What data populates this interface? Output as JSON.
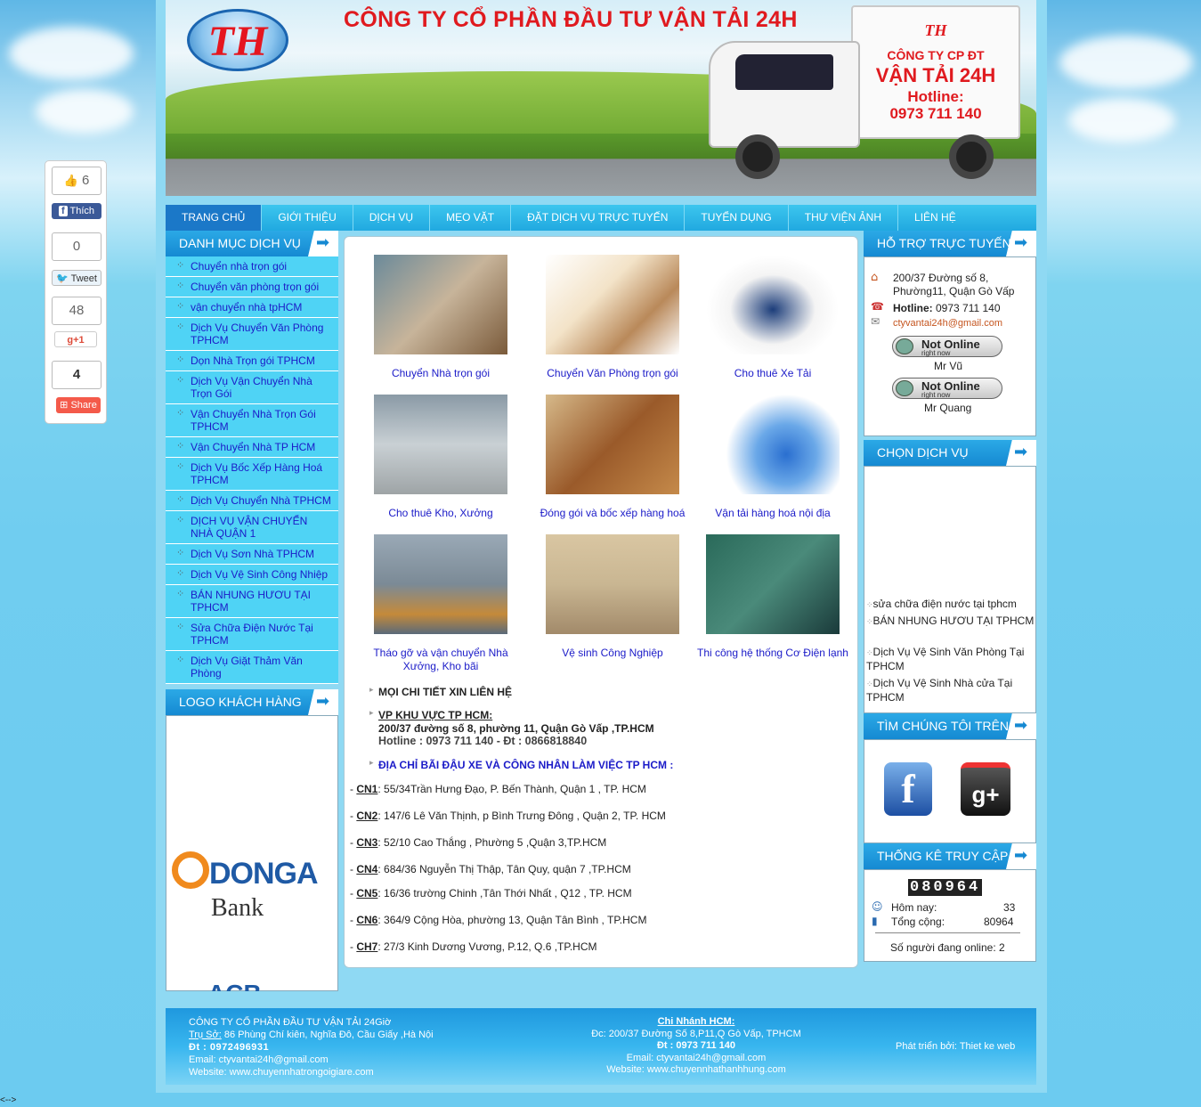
{
  "banner": {
    "logo": "TH",
    "title": "CÔNG TY CỔ PHẦN ĐẦU TƯ VẬN TẢI 24H",
    "truck_logo": "TH",
    "truck_line1": "CÔNG TY CP ĐT",
    "truck_line2": "VẬN TẢI 24H",
    "truck_line3": "Hotline:",
    "truck_line4": "0973 711 140"
  },
  "nav": [
    "TRANG CHỦ",
    "GIỚI THIỆU",
    "DỊCH VỤ",
    "MẸO VẶT",
    "ĐẶT DỊCH VỤ TRỰC TUYẾN",
    "TUYỂN DỤNG",
    "THƯ VIỆN ẢNH",
    "LIÊN HỆ"
  ],
  "left": {
    "menu_title": "DANH MỤC DỊCH VỤ",
    "items": [
      "Chuyển nhà trọn gói",
      "Chuyển văn phòng trọn gói",
      "vận chuyển nhà tpHCM",
      "Dịch Vụ Chuyển Văn Phòng TPHCM",
      "Dọn Nhà Trọn gói TPHCM",
      "Dịch Vụ Vận Chuyển Nhà Trọn Gói",
      "Vận Chuyển Nhà Trọn Gói TPHCM",
      "Vận Chuyển Nhà TP HCM",
      "Dịch Vụ Bốc Xếp Hàng Hoá TPHCM",
      "Dịch Vụ Chuyển Nhà TPHCM",
      "DỊCH VỤ VẬN CHUYỂN NHÀ QUẬN 1",
      "Dịch Vụ Sơn Nhà TPHCM",
      "Dịch Vụ Vệ Sinh Công Nhiệp",
      "BÁN NHUNG HƯƠU TẠI TPHCM",
      "Sửa Chữa Điện Nước Tại TPHCM",
      "Dịch Vụ Giặt Thảm Văn Phòng"
    ],
    "logos_title": "LOGO KHÁCH HÀNG",
    "donga_1": "DONGA",
    "donga_2": "Bank",
    "acb": "ACB"
  },
  "services": [
    "Chuyển Nhà trọn gói",
    "Chuyển Văn Phòng trọn gói",
    "Cho thuê Xe Tải",
    "Cho thuê Kho, Xưởng",
    "Đóng gói và bốc xếp hàng hoá",
    "Vận tải hàng hoá nội địa",
    "Tháo gỡ và vận chuyển Nhà Xưởng, Kho bãi",
    "Vệ sinh Công Nghiệp",
    "Thi công hệ thống Cơ Điện lạnh"
  ],
  "contact": {
    "line1": "MỌI CHI TIẾT XIN LIÊN HỆ",
    "vp_title": "VP KHU VỰC TP HCM:",
    "vp_addr": "200/37 đường số 8, phường 11, Quận Gò Vấp ,TP.HCM",
    "vp_phone": "Hotline : 0973 711 140 - Đt : 0866818840",
    "parking": "ĐỊA CHỈ BÃI ĐẬU XE VÀ CÔNG NHÂN LÀM VIỆC TP HCM :"
  },
  "branches": [
    {
      "code": "CN1",
      "addr": ": 55/34Trần Hưng Đạo, P. Bến Thành, Quận 1 , TP. HCM"
    },
    {
      "code": "CN2",
      "addr": ": 147/6 Lê Văn Thịnh, p Bình Trưng Đông , Quận 2, TP. HCM"
    },
    {
      "code": "CN3",
      "addr": ": 52/10 Cao Thắng , Phường 5 ,Quận 3,TP.HCM"
    },
    {
      "code": "CN4",
      "addr": ": 684/36 Nguyễn Thị Thập, Tân Quy, quận 7 ,TP.HCM"
    },
    {
      "code": "CN5",
      "addr": ": 16/36 trường Chinh ,Tân Thới Nhất , Q12 , TP. HCM"
    },
    {
      "code": "CN6",
      "addr": ": 364/9 Cộng Hòa, phường 13, Quận Tân Bình , TP.HCM"
    },
    {
      "code": "CH7",
      "addr": ": 27/3 Kinh Dương Vương, P.12, Q.6 ,TP.HCM"
    }
  ],
  "right": {
    "support_title": "HỖ TRỢ TRỰC TUYẾN",
    "addr1": "200/37 Đường số 8,",
    "addr2": "Phường11, Quận Gò Vấp",
    "hotline_label": "Hotline:",
    "hotline": " 0973 711 140",
    "email": "ctyvantai24h@gmail.com",
    "yahoo_status": "Not Online",
    "yahoo_sub": "right now",
    "support1": "Mr Vũ",
    "support2": "Mr Quang",
    "choose_title": "CHỌN DỊCH VỤ",
    "choose_items": [
      "sửa chữa điện nước tại tphcm",
      "BÁN NHUNG HƯƠU TẠI TPHCM",
      "Dịch Vụ Vệ Sinh Văn Phòng Tại TPHCM",
      "Dịch Vụ Vệ Sinh Nhà cửa Tại TPHCM"
    ],
    "find_title": "TÌM CHÚNG TÔI TRÊN",
    "stats_title": "THỐNG KÊ TRUY CẬP",
    "counter": "080964",
    "today_label": "Hôm nay:",
    "today": "33",
    "total_label": "Tổng cộng:",
    "total": "80964",
    "online": "Số người đang online: 2"
  },
  "social": {
    "likes": "6",
    "like_label": "Thích",
    "tweets": "0",
    "tweet_label": "Tweet",
    "gplus": "48",
    "gplus_label": "+1",
    "shares": "4",
    "share_label": "Share"
  },
  "footer": {
    "company": "CÔNG TY CỔ PHẦN ĐẦU TƯ VẬN TẢI 24Giờ",
    "hq_label": "Trụ Sở:",
    "hq": " 86 Phùng Chí kiên, Nghĩa Đô, Cầu Giấy ,Hà Nội",
    "phone": "Đt : 0972496931",
    "email": "Email: ctyvantai24h@gmail.com",
    "website": "Website: www.chuyennhatrongoigiare.com",
    "branch_title": "Chi Nhánh HCM:",
    "branch_addr": "Đc: 200/37 Đường Số 8,P11,Q Gò Vấp, TPHCM",
    "branch_phone": "Đt : 0973 711 140",
    "branch_email": "Email: ctyvantai24h@gmail.com",
    "branch_web": "Website: www.chuyennhathanhhung.com",
    "dev": "Phát triển bởi: Thiet ke web"
  },
  "stray": "<-->"
}
